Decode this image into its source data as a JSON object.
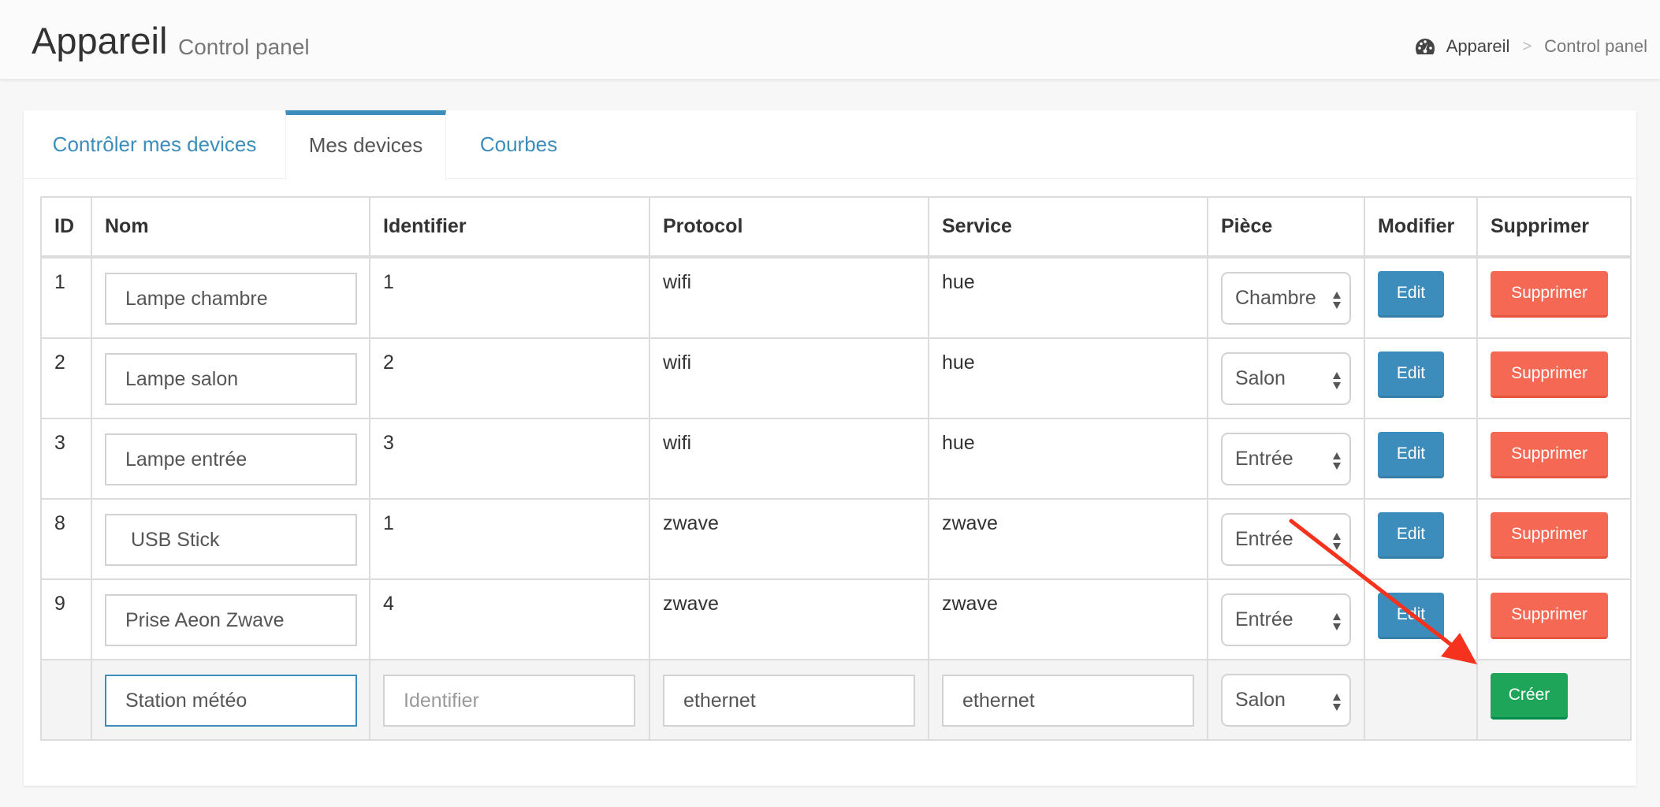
{
  "header": {
    "title": "Appareil",
    "subtitle": "Control panel",
    "breadcrumb": {
      "icon": "dashboard-icon",
      "items": [
        "Appareil",
        "Control panel"
      ],
      "separator": ">"
    }
  },
  "tabs": [
    {
      "label": "Contrôler mes devices",
      "active": false
    },
    {
      "label": "Mes devices",
      "active": true
    },
    {
      "label": "Courbes",
      "active": false
    }
  ],
  "table": {
    "columns": [
      "ID",
      "Nom",
      "Identifier",
      "Protocol",
      "Service",
      "Pièce",
      "Modifier",
      "Supprimer"
    ],
    "rows": [
      {
        "id": "1",
        "name": "Lampe chambre",
        "identifier": "1",
        "protocol": "wifi",
        "service": "hue",
        "room": "Chambre",
        "edit_label": "Edit",
        "delete_label": "Supprimer"
      },
      {
        "id": "2",
        "name": "Lampe salon",
        "identifier": "2",
        "protocol": "wifi",
        "service": "hue",
        "room": "Salon",
        "edit_label": "Edit",
        "delete_label": "Supprimer"
      },
      {
        "id": "3",
        "name": "Lampe entrée",
        "identifier": "3",
        "protocol": "wifi",
        "service": "hue",
        "room": "Entrée",
        "edit_label": "Edit",
        "delete_label": "Supprimer"
      },
      {
        "id": "8",
        "name": " USB Stick",
        "identifier": "1",
        "protocol": "zwave",
        "service": "zwave",
        "room": "Entrée",
        "edit_label": "Edit",
        "delete_label": "Supprimer"
      },
      {
        "id": "9",
        "name": "Prise Aeon Zwave",
        "identifier": "4",
        "protocol": "zwave",
        "service": "zwave",
        "room": "Entrée",
        "edit_label": "Edit",
        "delete_label": "Supprimer"
      }
    ],
    "new_row": {
      "name_value": "Station météo",
      "identifier_value": "",
      "identifier_placeholder": "Identifier",
      "protocol_value": "ethernet",
      "service_value": "ethernet",
      "room": "Salon",
      "create_label": "Créer"
    }
  },
  "colors": {
    "primary": "#3c8dbc",
    "danger": "#f56954",
    "success": "#1ea55a",
    "annotation_arrow": "#f4321e"
  }
}
